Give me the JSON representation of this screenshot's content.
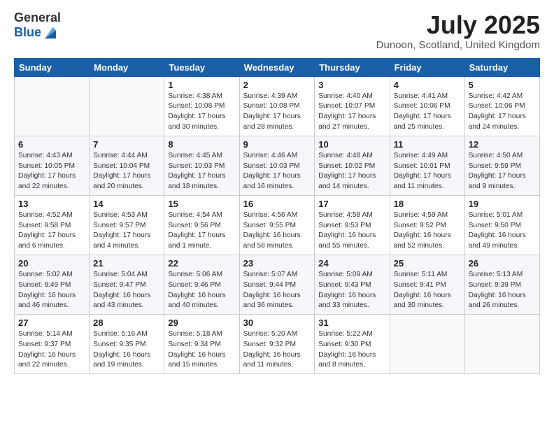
{
  "logo": {
    "general": "General",
    "blue": "Blue"
  },
  "title": "July 2025",
  "location": "Dunoon, Scotland, United Kingdom",
  "days_of_week": [
    "Sunday",
    "Monday",
    "Tuesday",
    "Wednesday",
    "Thursday",
    "Friday",
    "Saturday"
  ],
  "weeks": [
    [
      {
        "day": "",
        "info": ""
      },
      {
        "day": "",
        "info": ""
      },
      {
        "day": "1",
        "info": "Sunrise: 4:38 AM\nSunset: 10:08 PM\nDaylight: 17 hours and 30 minutes."
      },
      {
        "day": "2",
        "info": "Sunrise: 4:39 AM\nSunset: 10:08 PM\nDaylight: 17 hours and 28 minutes."
      },
      {
        "day": "3",
        "info": "Sunrise: 4:40 AM\nSunset: 10:07 PM\nDaylight: 17 hours and 27 minutes."
      },
      {
        "day": "4",
        "info": "Sunrise: 4:41 AM\nSunset: 10:06 PM\nDaylight: 17 hours and 25 minutes."
      },
      {
        "day": "5",
        "info": "Sunrise: 4:42 AM\nSunset: 10:06 PM\nDaylight: 17 hours and 24 minutes."
      }
    ],
    [
      {
        "day": "6",
        "info": "Sunrise: 4:43 AM\nSunset: 10:05 PM\nDaylight: 17 hours and 22 minutes."
      },
      {
        "day": "7",
        "info": "Sunrise: 4:44 AM\nSunset: 10:04 PM\nDaylight: 17 hours and 20 minutes."
      },
      {
        "day": "8",
        "info": "Sunrise: 4:45 AM\nSunset: 10:03 PM\nDaylight: 17 hours and 18 minutes."
      },
      {
        "day": "9",
        "info": "Sunrise: 4:46 AM\nSunset: 10:03 PM\nDaylight: 17 hours and 16 minutes."
      },
      {
        "day": "10",
        "info": "Sunrise: 4:48 AM\nSunset: 10:02 PM\nDaylight: 17 hours and 14 minutes."
      },
      {
        "day": "11",
        "info": "Sunrise: 4:49 AM\nSunset: 10:01 PM\nDaylight: 17 hours and 11 minutes."
      },
      {
        "day": "12",
        "info": "Sunrise: 4:50 AM\nSunset: 9:59 PM\nDaylight: 17 hours and 9 minutes."
      }
    ],
    [
      {
        "day": "13",
        "info": "Sunrise: 4:52 AM\nSunset: 9:58 PM\nDaylight: 17 hours and 6 minutes."
      },
      {
        "day": "14",
        "info": "Sunrise: 4:53 AM\nSunset: 9:57 PM\nDaylight: 17 hours and 4 minutes."
      },
      {
        "day": "15",
        "info": "Sunrise: 4:54 AM\nSunset: 9:56 PM\nDaylight: 17 hours and 1 minute."
      },
      {
        "day": "16",
        "info": "Sunrise: 4:56 AM\nSunset: 9:55 PM\nDaylight: 16 hours and 58 minutes."
      },
      {
        "day": "17",
        "info": "Sunrise: 4:58 AM\nSunset: 9:53 PM\nDaylight: 16 hours and 55 minutes."
      },
      {
        "day": "18",
        "info": "Sunrise: 4:59 AM\nSunset: 9:52 PM\nDaylight: 16 hours and 52 minutes."
      },
      {
        "day": "19",
        "info": "Sunrise: 5:01 AM\nSunset: 9:50 PM\nDaylight: 16 hours and 49 minutes."
      }
    ],
    [
      {
        "day": "20",
        "info": "Sunrise: 5:02 AM\nSunset: 9:49 PM\nDaylight: 16 hours and 46 minutes."
      },
      {
        "day": "21",
        "info": "Sunrise: 5:04 AM\nSunset: 9:47 PM\nDaylight: 16 hours and 43 minutes."
      },
      {
        "day": "22",
        "info": "Sunrise: 5:06 AM\nSunset: 9:46 PM\nDaylight: 16 hours and 40 minutes."
      },
      {
        "day": "23",
        "info": "Sunrise: 5:07 AM\nSunset: 9:44 PM\nDaylight: 16 hours and 36 minutes."
      },
      {
        "day": "24",
        "info": "Sunrise: 5:09 AM\nSunset: 9:43 PM\nDaylight: 16 hours and 33 minutes."
      },
      {
        "day": "25",
        "info": "Sunrise: 5:11 AM\nSunset: 9:41 PM\nDaylight: 16 hours and 30 minutes."
      },
      {
        "day": "26",
        "info": "Sunrise: 5:13 AM\nSunset: 9:39 PM\nDaylight: 16 hours and 26 minutes."
      }
    ],
    [
      {
        "day": "27",
        "info": "Sunrise: 5:14 AM\nSunset: 9:37 PM\nDaylight: 16 hours and 22 minutes."
      },
      {
        "day": "28",
        "info": "Sunrise: 5:16 AM\nSunset: 9:35 PM\nDaylight: 16 hours and 19 minutes."
      },
      {
        "day": "29",
        "info": "Sunrise: 5:18 AM\nSunset: 9:34 PM\nDaylight: 16 hours and 15 minutes."
      },
      {
        "day": "30",
        "info": "Sunrise: 5:20 AM\nSunset: 9:32 PM\nDaylight: 16 hours and 11 minutes."
      },
      {
        "day": "31",
        "info": "Sunrise: 5:22 AM\nSunset: 9:30 PM\nDaylight: 16 hours and 8 minutes."
      },
      {
        "day": "",
        "info": ""
      },
      {
        "day": "",
        "info": ""
      }
    ]
  ]
}
